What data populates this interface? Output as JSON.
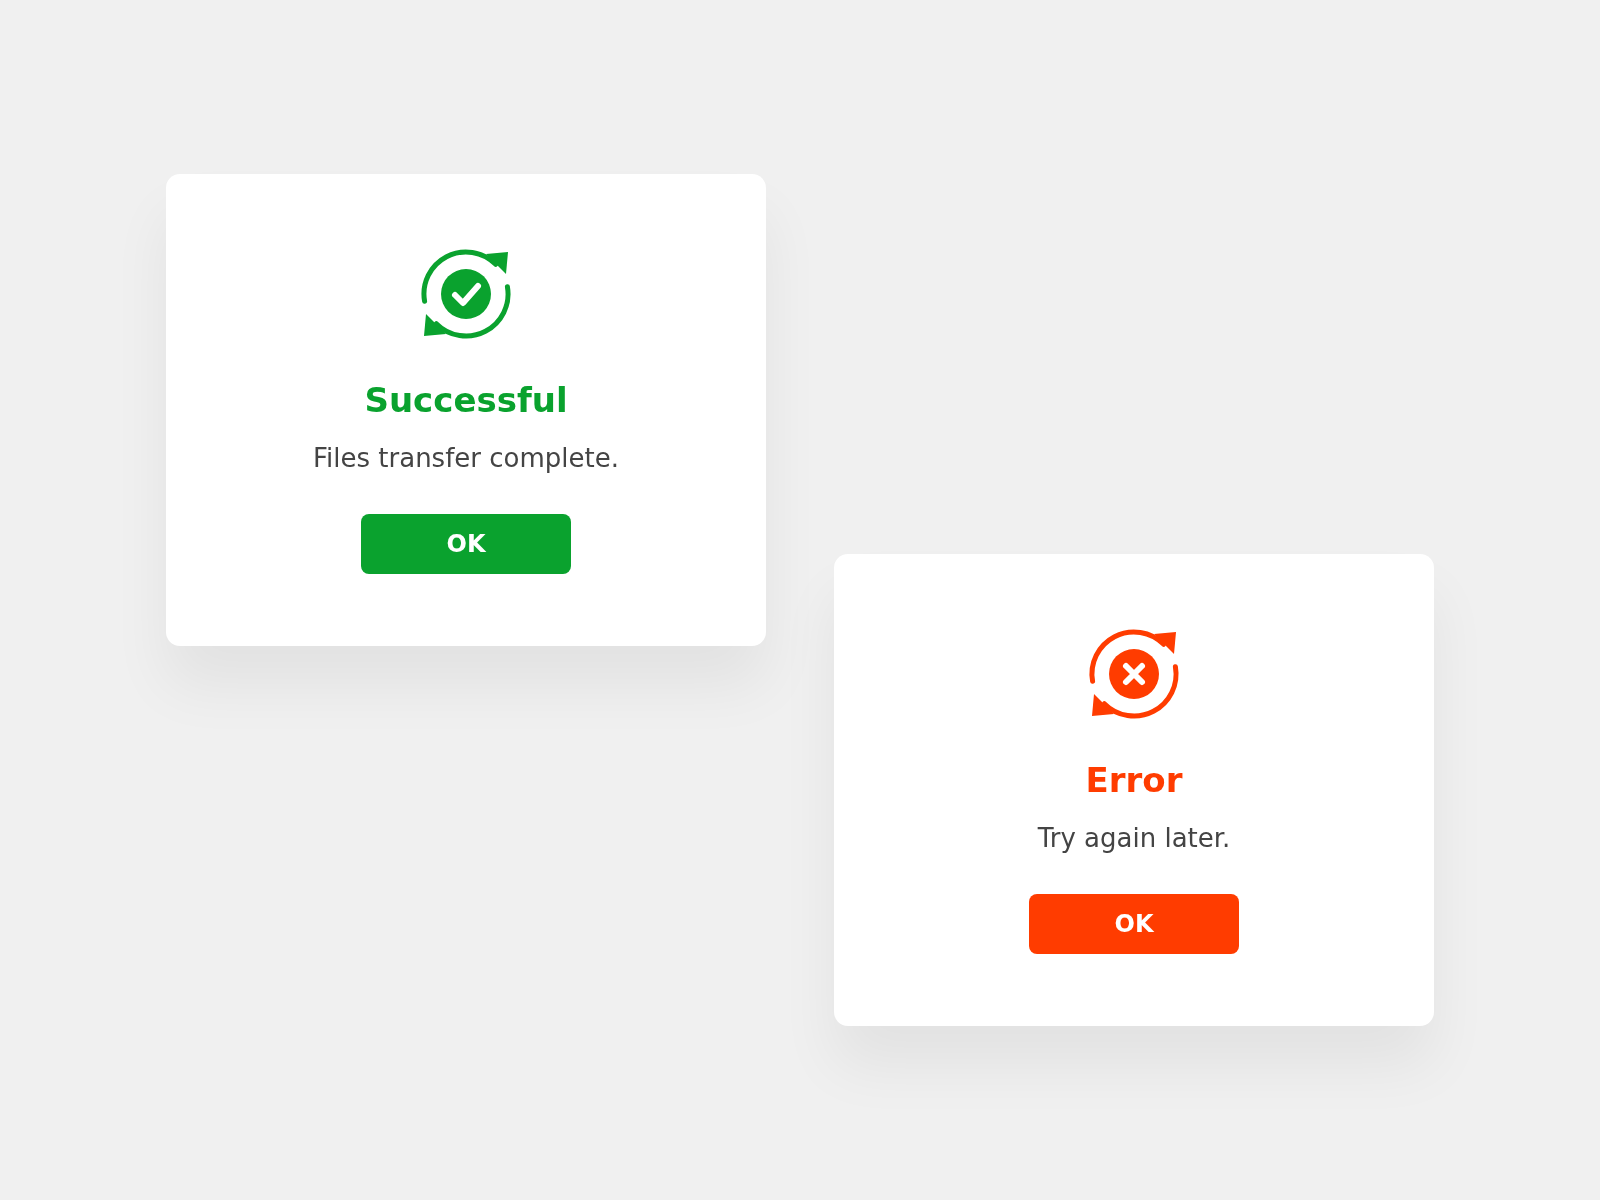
{
  "dialogs": [
    {
      "kind": "success",
      "color": "#0aa22e",
      "title": "Successful",
      "message": "Files transfer complete.",
      "button": "OK"
    },
    {
      "kind": "error",
      "color": "#ff3c00",
      "title": "Error",
      "message": "Try again later.",
      "button": "OK"
    }
  ]
}
